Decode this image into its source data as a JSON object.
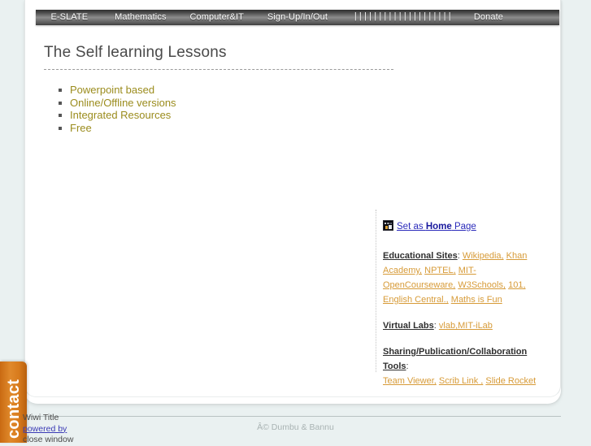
{
  "navbar": {
    "items": [
      {
        "label": "E-SLATE",
        "name": "nav-item-e-slate"
      },
      {
        "label": "Mathematics",
        "name": "nav-item-mathematics"
      },
      {
        "label": "Computer&IT",
        "name": "nav-item-computer-it"
      },
      {
        "label": "Sign-Up/In/Out",
        "name": "nav-item-sign-up-in-out"
      },
      {
        "label": "||||||||||||||||||||",
        "name": "nav-item-bars-glyph"
      },
      {
        "label": "Donate",
        "name": "nav-item-donate"
      }
    ]
  },
  "main": {
    "title": "The Self learning Lessons",
    "features": [
      "Powerpoint based",
      "Online/Offline versions",
      "Integrated Resources",
      "Free"
    ]
  },
  "links_panel": {
    "set_home": {
      "prefix": "Set as ",
      "bold": "Home",
      "suffix": " Page"
    },
    "educational": {
      "category": "Educational Sites",
      "separator": ": ",
      "links": [
        "Wikipedia,",
        "Khan Academy,",
        "NPTEL,",
        "MIT-OpenCourseware,",
        "W3Schools,",
        "101,",
        "English Central.,",
        "Maths is Fun"
      ]
    },
    "virtual_labs": {
      "category": "Virtual Labs",
      "separator": ": ",
      "links": [
        "vlab,MIT-iLab"
      ]
    },
    "sharing": {
      "category": "Sharing/Publication/Collaboration Tools",
      "separator": ":",
      "links": [
        "Team Viewer,",
        "Scrib Link ,",
        "Slide Rocket"
      ]
    }
  },
  "contact_tab": {
    "label": "contact"
  },
  "footer": {
    "wiwi_title": "Wiwi Title",
    "powered_by": "powered by",
    "close_window": "close window",
    "copyright": "Â© Dumbu & Bannu"
  },
  "colors": {
    "background": "#eaf1f1",
    "card": "#ffffff",
    "navbar_dark": "#2f2f2f",
    "feature_text": "#9b8c1d",
    "link_orange": "#d79b38",
    "link_blue": "#2b2bbb",
    "contact_orange": "#d87b1d",
    "title_gray": "#4a4a4a"
  }
}
